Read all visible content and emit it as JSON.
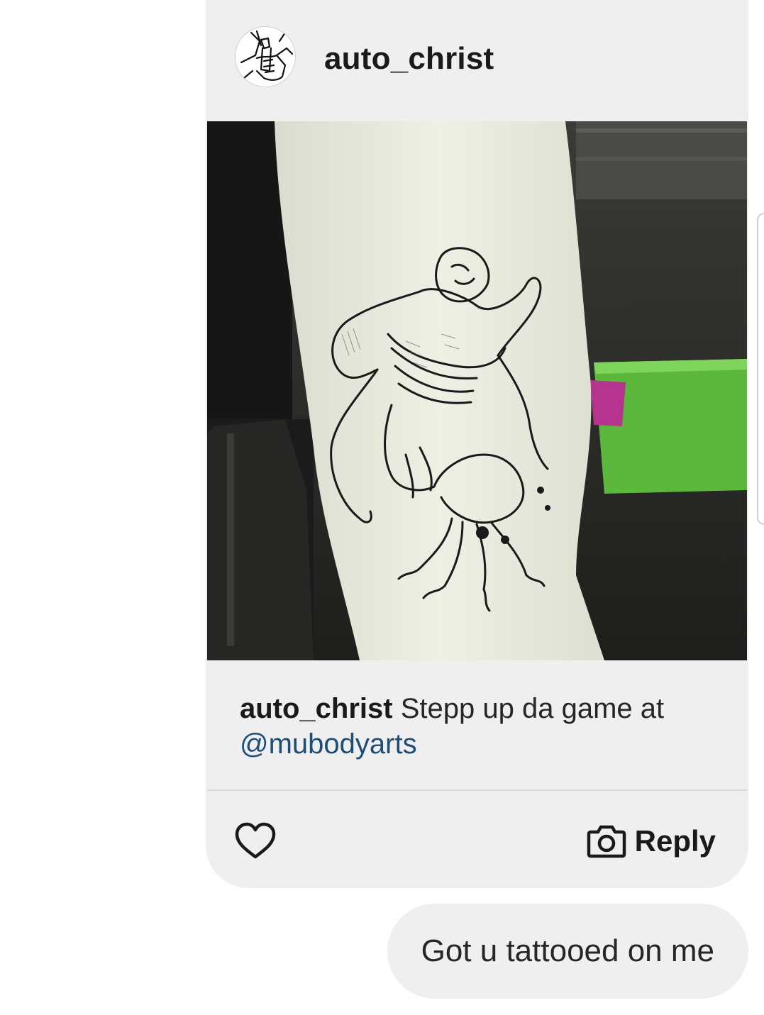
{
  "post": {
    "author": "auto_christ",
    "avatar_icon": "hand-holding-tool-sketch-icon",
    "image_description_icon": "tattoo-photo",
    "caption_user": "auto_christ",
    "caption_text": " Stepp up da game at ",
    "caption_mention": "@mubodyarts",
    "like_icon": "heart-icon",
    "reply_icon": "camera-icon",
    "reply_label": "Reply"
  },
  "message": {
    "text": "Got u tattooed on me"
  },
  "colors": {
    "bubble": "#efefef",
    "mention": "#1c4e78",
    "text": "#262626"
  }
}
